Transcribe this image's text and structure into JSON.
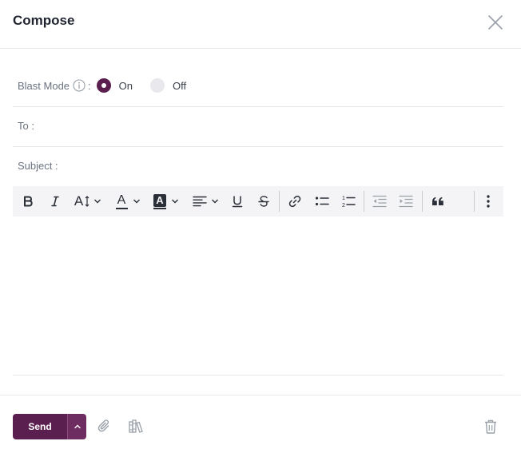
{
  "header": {
    "title": "Compose"
  },
  "blast_mode": {
    "label": "Blast Mode",
    "colon": ":",
    "options": [
      {
        "label": "On",
        "selected": true
      },
      {
        "label": "Off",
        "selected": false
      }
    ]
  },
  "fields": {
    "to_label": "To :",
    "subject_label": "Subject :"
  },
  "toolbar": {
    "icons": [
      "bold-icon",
      "italic-icon",
      "font-size-icon",
      "font-color-icon",
      "highlight-color-icon",
      "align-left-icon",
      "underline-icon",
      "strikethrough-icon",
      "link-icon",
      "bulleted-list-icon",
      "numbered-list-icon",
      "outdent-icon",
      "indent-icon",
      "blockquote-icon",
      "more-vertical-icon"
    ],
    "font_size_glyph": "A",
    "font_color_glyph": "A",
    "highlight_glyph": "A"
  },
  "footer": {
    "send_label": "Send",
    "icons": [
      "chevron-up-icon",
      "paperclip-icon",
      "templates-icon",
      "trash-icon"
    ]
  },
  "colors": {
    "accent": "#5b1f4f",
    "toolbar_bg": "#f4f4f6",
    "muted_text": "#6b7280"
  }
}
